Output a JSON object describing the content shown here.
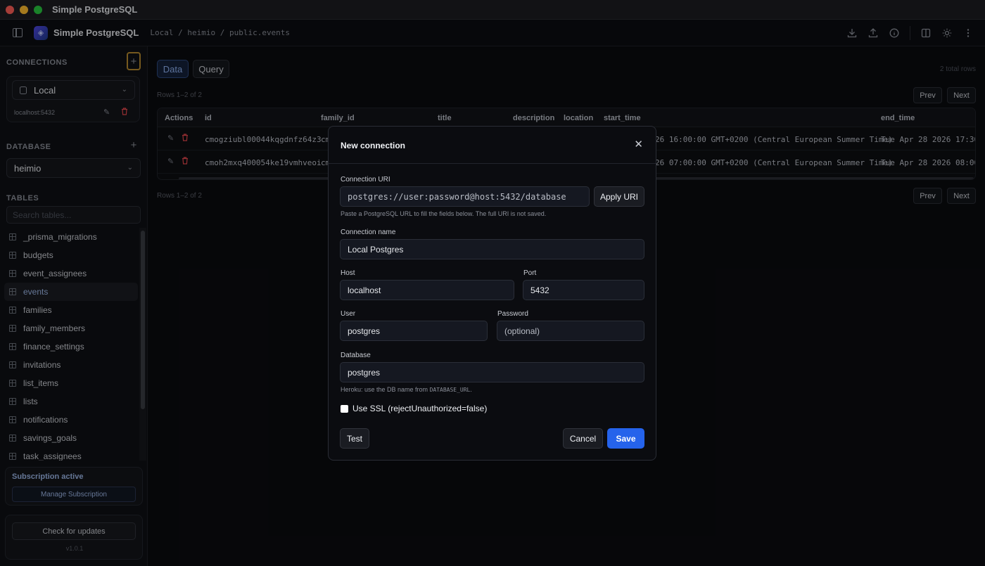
{
  "window": {
    "title": "Simple PostgreSQL"
  },
  "header": {
    "app_name": "Simple PostgreSQL",
    "breadcrumb": "Local / heimio / public.events",
    "icons": [
      "download-icon",
      "upload-icon",
      "info-icon",
      "columns-icon",
      "sun-icon",
      "more-vertical-icon"
    ]
  },
  "sidebar": {
    "connections_title": "CONNECTIONS",
    "connection": {
      "selected": "Local",
      "host": "localhost:5432"
    },
    "database_title": "DATABASE",
    "database_selected": "heimio",
    "tables_title": "TABLES",
    "search_placeholder": "Search tables...",
    "tables": [
      "_prisma_migrations",
      "budgets",
      "event_assignees",
      "events",
      "families",
      "family_members",
      "finance_settings",
      "invitations",
      "list_items",
      "lists",
      "notifications",
      "savings_goals",
      "task_assignees"
    ],
    "active_table": "events",
    "subscription": {
      "title": "Subscription active",
      "button": "Manage Subscription"
    },
    "updates": {
      "button": "Check for updates",
      "version": "v1.0.1"
    }
  },
  "main": {
    "tabs": {
      "data": "Data",
      "query": "Query"
    },
    "total_rows": "2 total rows",
    "rows_info": "Rows 1–2 of 2",
    "prev": "Prev",
    "next": "Next",
    "columns": [
      "Actions",
      "id",
      "family_id",
      "title",
      "description",
      "location",
      "start_time",
      "end_time"
    ],
    "rows": [
      {
        "id": "cmogziubl00044kqgdnfz64z3",
        "family_id": "cm",
        "start_time": "26 16:00:00 GMT+0200 (Central European Summer Time)",
        "end_time": "Tue Apr 28 2026 17:30:0"
      },
      {
        "id": "cmoh2mxq400054ke19vmhveoi",
        "family_id": "cm",
        "start_time": "26 07:00:00 GMT+0200 (Central European Summer Time)",
        "end_time": "Tue Apr 28 2026 08:00:0"
      }
    ]
  },
  "modal": {
    "title": "New connection",
    "uri_label": "Connection URI",
    "uri_placeholder": "postgres://user:password@host:5432/database",
    "apply_uri": "Apply URI",
    "uri_hint": "Paste a PostgreSQL URL to fill the fields below. The full URI is not saved.",
    "name_label": "Connection name",
    "name_value": "Local Postgres",
    "host_label": "Host",
    "host_value": "localhost",
    "port_label": "Port",
    "port_value": "5432",
    "user_label": "User",
    "user_value": "postgres",
    "password_label": "Password",
    "password_placeholder": "(optional)",
    "database_label": "Database",
    "database_value": "postgres",
    "db_hint_prefix": "Heroku: use the DB name from ",
    "db_hint_code": "DATABASE_URL",
    "db_hint_suffix": ".",
    "ssl_label": "Use SSL (rejectUnauthorized=false)",
    "test": "Test",
    "cancel": "Cancel",
    "save": "Save"
  },
  "colors": {
    "accent": "#2563eb",
    "danger": "#e5484d",
    "highlight": "#b5892f"
  }
}
